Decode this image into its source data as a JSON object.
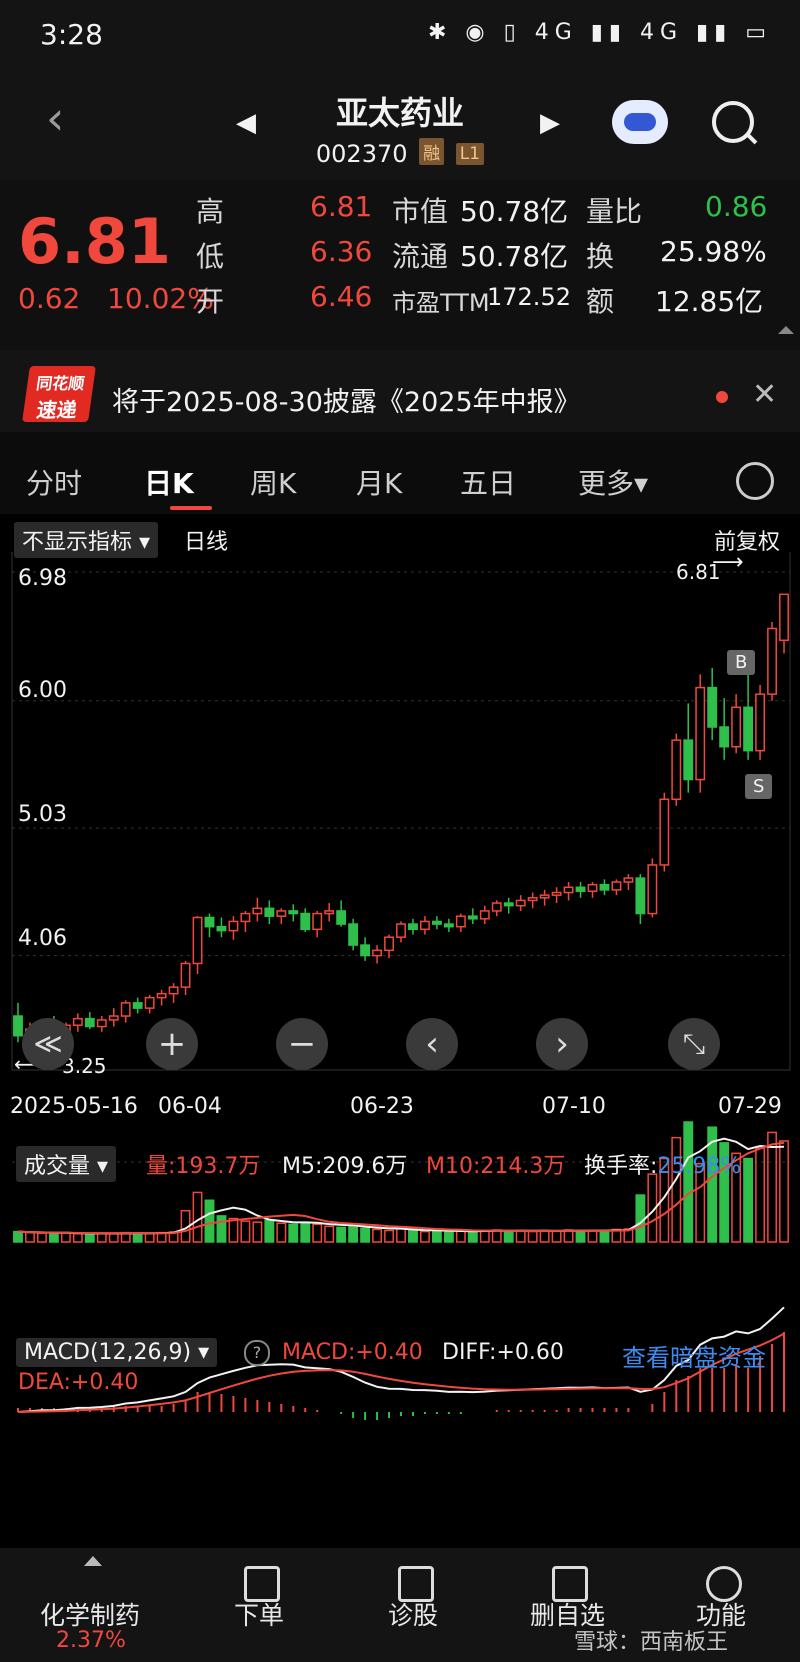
{
  "status_bar": {
    "time": "3:28",
    "icons": "✱ ◉ ▯ 4G ▮▮ 4G ▮▮ ▭"
  },
  "header": {
    "back": "‹",
    "prev": "◀",
    "next": "▶",
    "name": "亚太药业",
    "code": "002370",
    "tag_margin": "融",
    "tag_level": "L1"
  },
  "quote": {
    "price": "6.81",
    "change": "0.62",
    "change_pct": "10.02%",
    "high_label": "高",
    "high": "6.81",
    "low_label": "低",
    "low": "6.36",
    "open_label": "开",
    "open": "6.46",
    "mcap_label": "市值",
    "mcap": "50.78亿",
    "float_label": "流通",
    "float": "50.78亿",
    "pe_label": "市盈TTM",
    "pe": "172.52",
    "vr_label": "量比",
    "vr": "0.86",
    "turn_label": "换",
    "turn": "25.98%",
    "amt_label": "额",
    "amt": "12.85亿"
  },
  "notice": {
    "logo_top": "同花顺",
    "logo_bottom": "速递",
    "text": "将于2025-08-30披露《2025年中报》",
    "close": "✕"
  },
  "tabs": [
    "分时",
    "日K",
    "周K",
    "月K",
    "五日",
    "更多▾"
  ],
  "kline": {
    "indicator_select": "不显示指标 ▾",
    "period": "日线",
    "adjust": "前复权",
    "y_labels": [
      "6.98",
      "6.00",
      "5.03",
      "4.06"
    ],
    "max_label": "6.81",
    "min_label": "3.25",
    "x_labels": [
      "2025-05-16",
      "06-04",
      "06-23",
      "07-10",
      "07-29"
    ],
    "marker_b": "B",
    "marker_s": "S",
    "controls": [
      "≪",
      "+",
      "−",
      "‹",
      "›",
      "⤡"
    ]
  },
  "volume": {
    "select": "成交量 ▾",
    "vol_label": "量:193.7万",
    "m5_label": "M5:209.6万",
    "m10_label": "M10:214.3万",
    "turn_label": "换手率:",
    "turn_value": "25.98%"
  },
  "macd": {
    "select": "MACD(12,26,9) ▾",
    "help": "?",
    "macd_label": "MACD:+0.40",
    "diff_label": "DIFF:+0.60",
    "dea_label": "DEA:+0.40",
    "link": "查看暗盘资金"
  },
  "bottom_nav": {
    "sector": "化学制药",
    "sector_pct": "2.37%",
    "order": "下单",
    "diagnose": "诊股",
    "remove_fav": "删自选",
    "functions": "功能",
    "watermark": "雪球：西南板王"
  },
  "chart_data": {
    "type": "candlestick",
    "title": "日线",
    "ylim": [
      3.25,
      6.98
    ],
    "x_labels": [
      "2025-05-16",
      "06-04",
      "06-23",
      "07-10",
      "07-29"
    ],
    "candles_ohlc": [
      [
        3.6,
        3.7,
        3.4,
        3.45
      ],
      [
        3.45,
        3.55,
        3.35,
        3.5
      ],
      [
        3.5,
        3.58,
        3.44,
        3.52
      ],
      [
        3.52,
        3.6,
        3.46,
        3.48
      ],
      [
        3.48,
        3.55,
        3.4,
        3.53
      ],
      [
        3.53,
        3.62,
        3.48,
        3.58
      ],
      [
        3.58,
        3.63,
        3.5,
        3.52
      ],
      [
        3.52,
        3.6,
        3.48,
        3.57
      ],
      [
        3.57,
        3.66,
        3.52,
        3.6
      ],
      [
        3.6,
        3.72,
        3.55,
        3.7
      ],
      [
        3.7,
        3.74,
        3.62,
        3.66
      ],
      [
        3.66,
        3.76,
        3.62,
        3.74
      ],
      [
        3.74,
        3.8,
        3.68,
        3.77
      ],
      [
        3.77,
        3.85,
        3.7,
        3.82
      ],
      [
        3.82,
        4.02,
        3.76,
        4.0
      ],
      [
        4.0,
        4.36,
        3.92,
        4.35
      ],
      [
        4.35,
        4.38,
        4.2,
        4.28
      ],
      [
        4.28,
        4.35,
        4.2,
        4.25
      ],
      [
        4.25,
        4.36,
        4.18,
        4.32
      ],
      [
        4.32,
        4.4,
        4.24,
        4.38
      ],
      [
        4.38,
        4.5,
        4.32,
        4.42
      ],
      [
        4.42,
        4.48,
        4.3,
        4.36
      ],
      [
        4.36,
        4.42,
        4.3,
        4.4
      ],
      [
        4.4,
        4.45,
        4.32,
        4.38
      ],
      [
        4.38,
        4.42,
        4.24,
        4.26
      ],
      [
        4.26,
        4.4,
        4.2,
        4.38
      ],
      [
        4.38,
        4.46,
        4.32,
        4.4
      ],
      [
        4.4,
        4.48,
        4.28,
        4.3
      ],
      [
        4.3,
        4.34,
        4.1,
        4.14
      ],
      [
        4.14,
        4.2,
        4.02,
        4.06
      ],
      [
        4.06,
        4.14,
        4.0,
        4.1
      ],
      [
        4.1,
        4.22,
        4.04,
        4.2
      ],
      [
        4.2,
        4.32,
        4.16,
        4.3
      ],
      [
        4.3,
        4.34,
        4.22,
        4.26
      ],
      [
        4.26,
        4.36,
        4.22,
        4.32
      ],
      [
        4.32,
        4.36,
        4.26,
        4.3
      ],
      [
        4.3,
        4.34,
        4.24,
        4.28
      ],
      [
        4.28,
        4.38,
        4.24,
        4.36
      ],
      [
        4.36,
        4.42,
        4.3,
        4.34
      ],
      [
        4.34,
        4.44,
        4.3,
        4.4
      ],
      [
        4.4,
        4.48,
        4.36,
        4.46
      ],
      [
        4.46,
        4.5,
        4.38,
        4.44
      ],
      [
        4.44,
        4.52,
        4.4,
        4.48
      ],
      [
        4.48,
        4.54,
        4.42,
        4.5
      ],
      [
        4.5,
        4.56,
        4.44,
        4.52
      ],
      [
        4.52,
        4.58,
        4.46,
        4.54
      ],
      [
        4.54,
        4.62,
        4.48,
        4.58
      ],
      [
        4.58,
        4.62,
        4.5,
        4.55
      ],
      [
        4.55,
        4.62,
        4.5,
        4.6
      ],
      [
        4.6,
        4.64,
        4.52,
        4.56
      ],
      [
        4.56,
        4.64,
        4.52,
        4.62
      ],
      [
        4.62,
        4.68,
        4.56,
        4.65
      ],
      [
        4.65,
        4.68,
        4.3,
        4.38
      ],
      [
        4.38,
        4.8,
        4.35,
        4.75
      ],
      [
        4.75,
        5.3,
        4.7,
        5.25
      ],
      [
        5.25,
        5.75,
        5.2,
        5.7
      ],
      [
        5.7,
        5.98,
        5.3,
        5.4
      ],
      [
        5.4,
        6.2,
        5.3,
        6.1
      ],
      [
        6.1,
        6.25,
        5.7,
        5.8
      ],
      [
        5.8,
        6.02,
        5.55,
        5.65
      ],
      [
        5.65,
        6.05,
        5.6,
        5.95
      ],
      [
        5.95,
        6.25,
        5.55,
        5.62
      ],
      [
        5.62,
        6.12,
        5.55,
        6.05
      ],
      [
        6.05,
        6.6,
        6.0,
        6.55
      ],
      [
        6.46,
        6.81,
        6.36,
        6.81
      ]
    ],
    "volume_wan": [
      20,
      18,
      17,
      16,
      18,
      16,
      15,
      17,
      16,
      18,
      17,
      16,
      18,
      19,
      60,
      95,
      80,
      50,
      45,
      40,
      38,
      42,
      36,
      34,
      38,
      34,
      30,
      28,
      30,
      26,
      24,
      22,
      26,
      22,
      20,
      21,
      20,
      22,
      20,
      22,
      23,
      21,
      22,
      20,
      22,
      21,
      23,
      22,
      21,
      22,
      24,
      25,
      90,
      130,
      160,
      200,
      230,
      150,
      220,
      190,
      170,
      160,
      180,
      210,
      193.7
    ],
    "macd_hist": [
      0.02,
      0.02,
      0.02,
      0.02,
      0.02,
      0.02,
      0.02,
      0.02,
      0.03,
      0.03,
      0.03,
      0.03,
      0.03,
      0.04,
      0.06,
      0.1,
      0.1,
      0.09,
      0.08,
      0.07,
      0.06,
      0.05,
      0.04,
      0.03,
      0.02,
      0.01,
      0.0,
      -0.01,
      -0.03,
      -0.04,
      -0.04,
      -0.03,
      -0.02,
      -0.02,
      -0.01,
      -0.01,
      -0.01,
      -0.01,
      0.0,
      0.0,
      0.01,
      0.01,
      0.01,
      0.01,
      0.01,
      0.01,
      0.02,
      0.02,
      0.02,
      0.02,
      0.02,
      0.02,
      0.0,
      0.04,
      0.1,
      0.16,
      0.18,
      0.22,
      0.22,
      0.22,
      0.24,
      0.22,
      0.28,
      0.34,
      0.4
    ],
    "labels": {
      "volume": "量:193.7万",
      "m5": "M5:209.6万",
      "m10": "M10:214.3万",
      "macd": "MACD:+0.40",
      "diff": "DIFF:+0.60",
      "dea": "DEA:+0.40"
    }
  }
}
